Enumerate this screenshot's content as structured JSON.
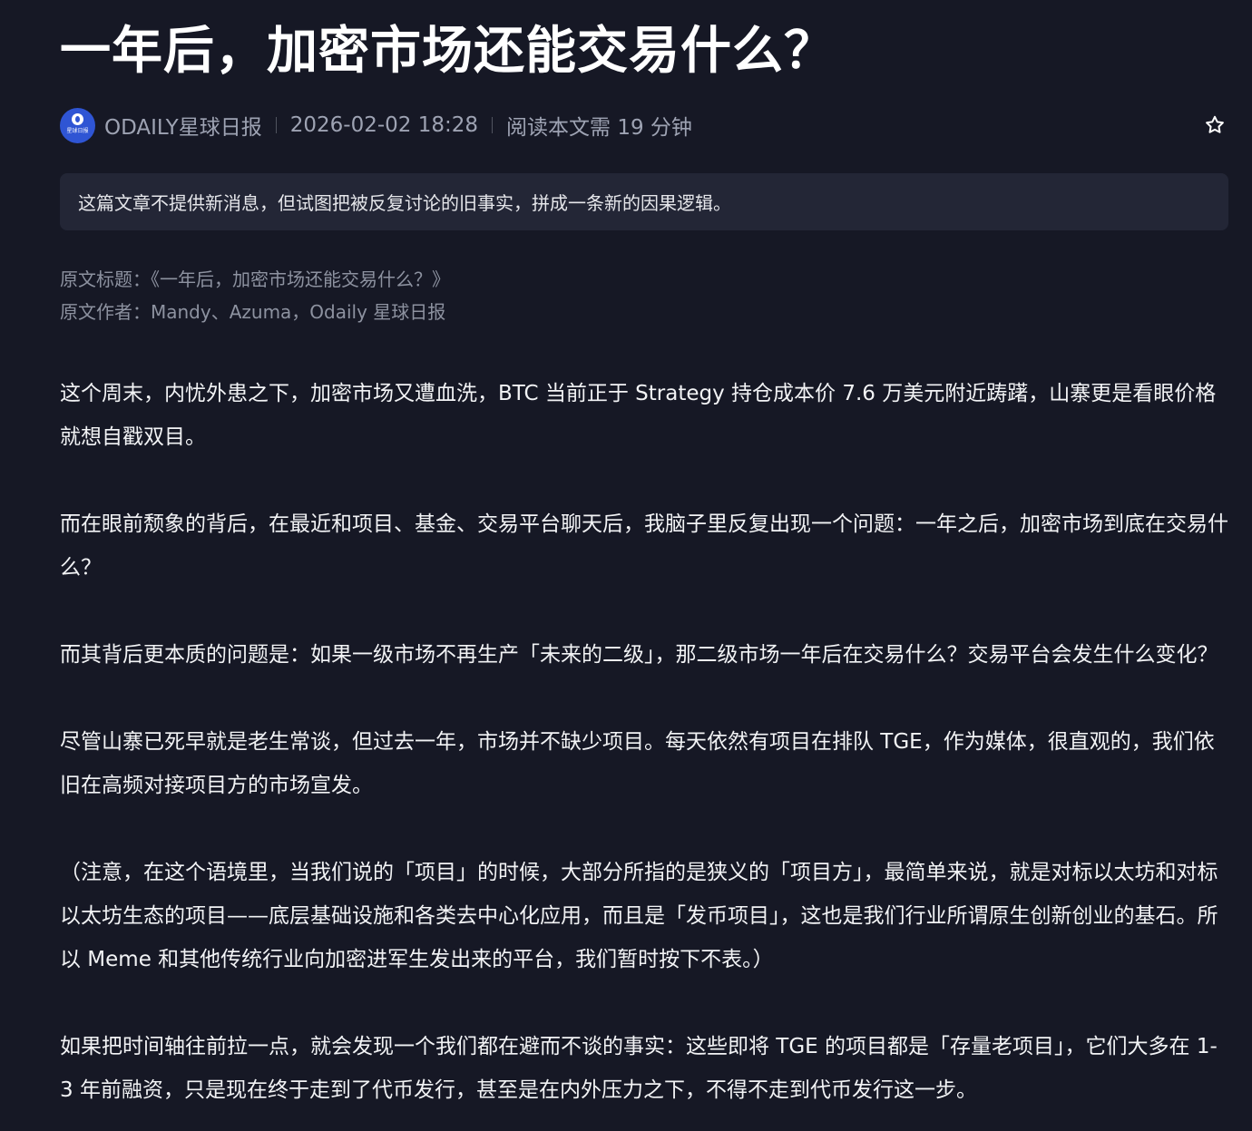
{
  "article": {
    "title": "一年后，加密市场还能交易什么？",
    "source_name": "ODAILY星球日报",
    "avatar_text": "星球日报",
    "date": "2026-02-02 18:28",
    "read_time": "阅读本文需 19 分钟",
    "summary": "这篇文章不提供新消息，但试图把被反复讨论的旧事实，拼成一条新的因果逻辑。",
    "original_title": "原文标题：《一年后，加密市场还能交易什么？》",
    "original_author": "原文作者：Mandy、Azuma，Odaily 星球日报",
    "paragraphs": [
      "这个周末，内忧外患之下，加密市场又遭血洗，BTC 当前正于 Strategy 持仓成本价 7.6 万美元附近踌躇，山寨更是看眼价格就想自戳双目。",
      "而在眼前颓象的背后，在最近和项目、基金、交易平台聊天后，我脑子里反复出现一个问题：一年之后，加密市场到底在交易什么？",
      "而其背后更本质的问题是：如果一级市场不再生产「未来的二级」，那二级市场一年后在交易什么？交易平台会发生什么变化？",
      "尽管山寨已死早就是老生常谈，但过去一年，市场并不缺少项目。每天依然有项目在排队 TGE，作为媒体，很直观的，我们依旧在高频对接项目方的市场宣发。",
      "（注意，在这个语境里，当我们说的「项目」的时候，大部分所指的是狭义的「项目方」，最简单来说，就是对标以太坊和对标以太坊生态的项目——底层基础设施和各类去中心化应用，而且是「发币项目」，这也是我们行业所谓原生创新创业的基石。所以 Meme 和其他传统行业向加密进军生发出来的平台，我们暂时按下不表。）",
      "如果把时间轴往前拉一点，就会发现一个我们都在避而不谈的事实：这些即将 TGE 的项目都是「存量老项目」，它们大多在 1-3 年前融资，只是现在终于走到了代币发行，甚至是在内外压力之下，不得不走到代币发行这一步。"
    ]
  },
  "icons": {
    "favorite": "star-outline-icon",
    "avatar": "odaily-logo-icon"
  },
  "colors": {
    "background": "#161825",
    "summary_background": "#232636",
    "avatar_blue": "#2f55d4",
    "meta_text": "#9ea3b3"
  }
}
